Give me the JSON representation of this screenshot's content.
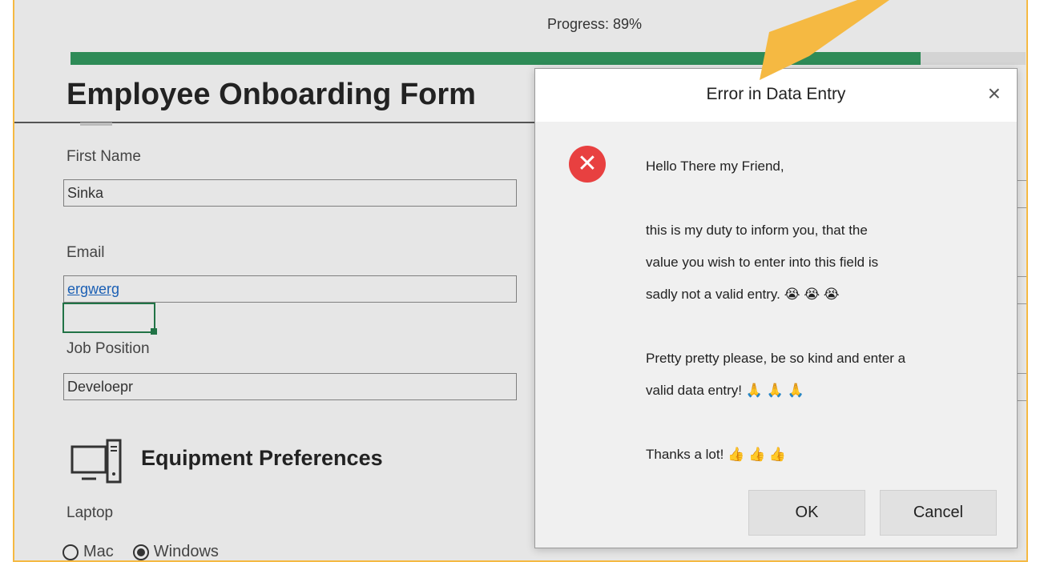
{
  "progress": {
    "label": "Progress: 89%",
    "value": 0.89
  },
  "form": {
    "title": "Employee Onboarding Form",
    "fields": [
      {
        "label": "First Name",
        "value": "Sinka"
      },
      {
        "label": "Email",
        "value": "ergwerg"
      },
      {
        "label": "Job Position",
        "value": "Develoepr"
      }
    ],
    "section_title": "Equipment Preferences",
    "laptop_label": "Laptop",
    "laptop_options": [
      {
        "label": "Mac",
        "checked": false
      },
      {
        "label": "Windows",
        "checked": true
      }
    ]
  },
  "dialog": {
    "title": "Error in Data Entry",
    "close_icon": "×",
    "message_lines": [
      "Hello There my Friend,",
      "this is my duty to inform you, that the",
      "value you wish to enter into this field is",
      "sadly not a valid entry. 😭 😭 😭",
      "Pretty pretty please, be so kind and enter a",
      "valid data entry! 🙏 🙏 🙏",
      "Thanks a lot! 👍 👍 👍"
    ],
    "ok_label": "OK",
    "cancel_label": "Cancel"
  },
  "colors": {
    "accent_orange": "#f5b942",
    "progress_green": "#2e8b57",
    "error_red": "#e84040",
    "link_blue": "#1a5fb4"
  },
  "icons": [
    "error-icon",
    "close-icon",
    "computer-icon",
    "callout-arrow-icon"
  ]
}
